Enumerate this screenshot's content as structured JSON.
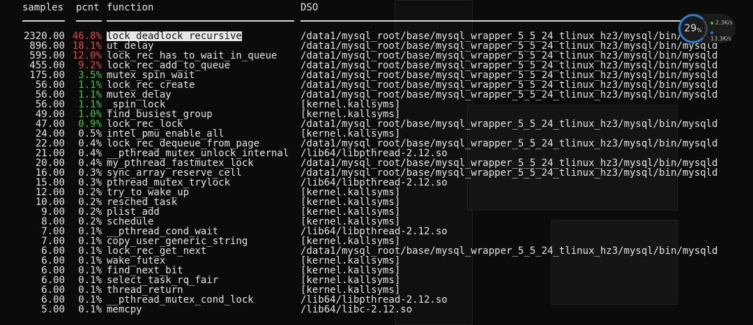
{
  "header": {
    "samples": "samples",
    "pcnt": "pcnt",
    "function": "function",
    "dso": "DSO"
  },
  "colors": {
    "red": "#e84646",
    "green": "#3cc83c",
    "default": "#e4e4e4"
  },
  "rows": [
    {
      "samples": "2320.00",
      "pcnt": "46.8%",
      "function": "lock_deadlock_recursive",
      "dso": "/data1/mysql_root/base/mysql_wrapper_5_5_24_tlinux_hz3/mysql/bin/mysqld",
      "color": "red",
      "selected": true
    },
    {
      "samples": "896.00",
      "pcnt": "18.1%",
      "function": "ut_delay",
      "dso": "/data1/mysql_root/base/mysql_wrapper_5_5_24_tlinux_hz3/mysql/bin/mysqld",
      "color": "red"
    },
    {
      "samples": "595.00",
      "pcnt": "12.0%",
      "function": "lock_rec_has_to_wait_in_queue",
      "dso": "/data1/mysql_root/base/mysql_wrapper_5_5_24_tlinux_hz3/mysql/bin/mysqld",
      "color": "red"
    },
    {
      "samples": "455.00",
      "pcnt": "9.2%",
      "function": "lock_rec_add_to_queue",
      "dso": "/data1/mysql_root/base/mysql_wrapper_5_5_24_tlinux_hz3/mysql/bin/mysqld",
      "color": "red"
    },
    {
      "samples": "175.00",
      "pcnt": "3.5%",
      "function": "mutex_spin_wait",
      "dso": "/data1/mysql_root/base/mysql_wrapper_5_5_24_tlinux_hz3/mysql/bin/mysqld",
      "color": "green"
    },
    {
      "samples": "56.00",
      "pcnt": "1.1%",
      "function": "lock_rec_create",
      "dso": "/data1/mysql_root/base/mysql_wrapper_5_5_24_tlinux_hz3/mysql/bin/mysqld",
      "color": "green"
    },
    {
      "samples": "56.00",
      "pcnt": "1.1%",
      "function": "mutex_delay",
      "dso": "/data1/mysql_root/base/mysql_wrapper_5_5_24_tlinux_hz3/mysql/bin/mysqld",
      "color": "green"
    },
    {
      "samples": "56.00",
      "pcnt": "1.1%",
      "function": "_spin_lock",
      "dso": "[kernel.kallsyms]",
      "color": "green"
    },
    {
      "samples": "49.00",
      "pcnt": "1.0%",
      "function": "find_busiest_group",
      "dso": "[kernel.kallsyms]",
      "color": "green"
    },
    {
      "samples": "47.00",
      "pcnt": "0.9%",
      "function": "lock_rec_lock",
      "dso": "/data1/mysql_root/base/mysql_wrapper_5_5_24_tlinux_hz3/mysql/bin/mysqld",
      "color": "green"
    },
    {
      "samples": "24.00",
      "pcnt": "0.5%",
      "function": "intel_pmu_enable_all",
      "dso": "[kernel.kallsyms]",
      "color": "default"
    },
    {
      "samples": "22.00",
      "pcnt": "0.4%",
      "function": "lock_rec_dequeue_from_page",
      "dso": "/data1/mysql_root/base/mysql_wrapper_5_5_24_tlinux_hz3/mysql/bin/mysqld",
      "color": "default"
    },
    {
      "samples": "21.00",
      "pcnt": "0.4%",
      "function": "__pthread_mutex_unlock_internal",
      "dso": "/lib64/libpthread-2.12.so",
      "color": "default"
    },
    {
      "samples": "20.00",
      "pcnt": "0.4%",
      "function": "my_pthread_fastmutex_lock",
      "dso": "/data1/mysql_root/base/mysql_wrapper_5_5_24_tlinux_hz3/mysql/bin/mysqld",
      "color": "default"
    },
    {
      "samples": "16.00",
      "pcnt": "0.3%",
      "function": "sync_array_reserve_cell",
      "dso": "/data1/mysql_root/base/mysql_wrapper_5_5_24_tlinux_hz3/mysql/bin/mysqld",
      "color": "default"
    },
    {
      "samples": "15.00",
      "pcnt": "0.3%",
      "function": "pthread_mutex_trylock",
      "dso": "/lib64/libpthread-2.12.so",
      "color": "default"
    },
    {
      "samples": "12.00",
      "pcnt": "0.2%",
      "function": "try_to_wake_up",
      "dso": "[kernel.kallsyms]",
      "color": "default"
    },
    {
      "samples": "10.00",
      "pcnt": "0.2%",
      "function": "resched_task",
      "dso": "[kernel.kallsyms]",
      "color": "default"
    },
    {
      "samples": "9.00",
      "pcnt": "0.2%",
      "function": "plist_add",
      "dso": "[kernel.kallsyms]",
      "color": "default"
    },
    {
      "samples": "8.00",
      "pcnt": "0.2%",
      "function": "schedule",
      "dso": "[kernel.kallsyms]",
      "color": "default"
    },
    {
      "samples": "7.00",
      "pcnt": "0.1%",
      "function": "__pthread_cond_wait",
      "dso": "/lib64/libpthread-2.12.so",
      "color": "default"
    },
    {
      "samples": "7.00",
      "pcnt": "0.1%",
      "function": "copy_user_generic_string",
      "dso": "[kernel.kallsyms]",
      "color": "default"
    },
    {
      "samples": "6.00",
      "pcnt": "0.1%",
      "function": "lock_rec_get_next",
      "dso": "/data1/mysql_root/base/mysql_wrapper_5_5_24_tlinux_hz3/mysql/bin/mysqld",
      "color": "default"
    },
    {
      "samples": "6.00",
      "pcnt": "0.1%",
      "function": "wake_futex",
      "dso": "[kernel.kallsyms]",
      "color": "default"
    },
    {
      "samples": "6.00",
      "pcnt": "0.1%",
      "function": "find_next_bit",
      "dso": "[kernel.kallsyms]",
      "color": "default"
    },
    {
      "samples": "6.00",
      "pcnt": "0.1%",
      "function": "select_task_rq_fair",
      "dso": "[kernel.kallsyms]",
      "color": "default"
    },
    {
      "samples": "6.00",
      "pcnt": "0.1%",
      "function": "thread_return",
      "dso": "[kernel.kallsyms]",
      "color": "default"
    },
    {
      "samples": "6.00",
      "pcnt": "0.1%",
      "function": "__pthread_mutex_cond_lock",
      "dso": "/lib64/libpthread-2.12.so",
      "color": "default"
    },
    {
      "samples": "5.00",
      "pcnt": "0.1%",
      "function": "memcpy",
      "dso": "/lib64/libc-2.12.so",
      "color": "default"
    }
  ],
  "widget": {
    "cpu_percent": "29",
    "cpu_unit": "%",
    "up_rate": "2.3K/s",
    "down_rate": "13.3K/s",
    "up_color": "#3cc83c",
    "down_color": "#2e7fd6"
  }
}
